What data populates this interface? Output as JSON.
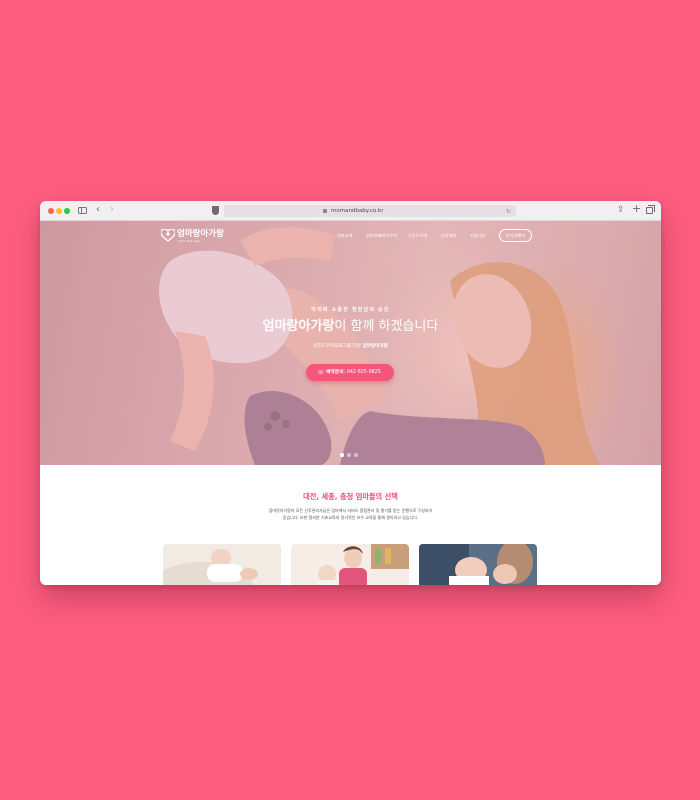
{
  "browser": {
    "url": "momandbaby.co.kr",
    "back_icon": "‹",
    "forward_icon": "›",
    "reload_icon": "↻",
    "share_icon": "⇪",
    "new_tab_icon": "+"
  },
  "site": {
    "logo_text": "엄마랑아가랑",
    "logo_sub": "mom and baby",
    "nav": [
      "엄마소개",
      "엄마아빠와아우미",
      "산후도우미",
      "산후케어",
      "커뮤니티"
    ],
    "consult_label": "온라인예약"
  },
  "hero": {
    "eyebrow": "아이의 소중한 첫만남의 순간",
    "title_brand": "엄마랑아가랑",
    "title_rest": "이 함께 하겠습니다",
    "sub_prefix": "산후도우미프로그램 전문 ",
    "sub_brand": "엄마랑아가랑",
    "reserve_icon": "☏",
    "reserve_label": "예약문의",
    "reserve_phone": "042-825-0825",
    "slides_total": 3,
    "slide_active": 1
  },
  "section": {
    "title": "대전, 세종, 충청 엄마들의 선택",
    "desc_line1": "엄마랑아가랑의 모든 산후관리사님은 엄마에서 서비스 품질관리 및 평가를 받는 운행으로 구성되어",
    "desc_line2": "있습니다. 또한 철저한 기초교육과 정기적인 보수 교육을 통해 관리하고 있습니다."
  },
  "colors": {
    "background": "#fd5e80",
    "accent": "#f5577b",
    "section_title": "#f14b73"
  }
}
